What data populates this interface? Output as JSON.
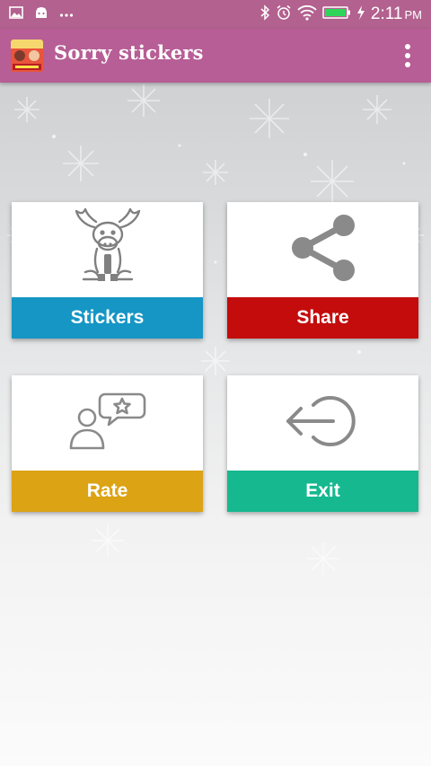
{
  "status_bar": {
    "time": "2:11",
    "ampm": "PM",
    "icons": [
      "image-icon",
      "android-icon",
      "more-dots-icon",
      "bluetooth-icon",
      "alarm-icon",
      "wifi-icon",
      "battery-icon",
      "charging-icon"
    ]
  },
  "app_bar": {
    "title": "Sorry stickers",
    "logo_icon": "app-logo-icon",
    "menu_icon": "overflow-menu-icon",
    "background": "#b65e95"
  },
  "tiles": [
    {
      "label": "Stickers",
      "icon": "moose-sticker-icon",
      "color": "#1596c5"
    },
    {
      "label": "Share",
      "icon": "share-icon",
      "color": "#c40c0c"
    },
    {
      "label": "Rate",
      "icon": "rate-user-star-icon",
      "color": "#dca314"
    },
    {
      "label": "Exit",
      "icon": "exit-icon",
      "color": "#15b88f"
    }
  ]
}
